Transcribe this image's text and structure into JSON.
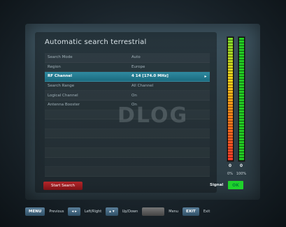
{
  "screen": {
    "title": "Automatic search terrestrial",
    "watermark": "DLOG",
    "menu": [
      {
        "label": "Search Mode",
        "value": "Auto",
        "selected": false
      },
      {
        "label": "Region",
        "value": "Europe",
        "selected": false
      },
      {
        "label": "RF Channel",
        "value": "4 14 [174.0 MHz]",
        "selected": true
      },
      {
        "label": "Search Range",
        "value": "All Channel",
        "selected": false
      },
      {
        "label": "Logical Channel",
        "value": "On",
        "selected": false
      },
      {
        "label": "Antenna Booster",
        "value": "On",
        "selected": false
      }
    ],
    "start_button": "Start Search",
    "signal_label": "Signal",
    "signal_status": "OK",
    "meters": [
      {
        "name": "strength",
        "value_text": "0",
        "percent_text": "0%",
        "level": 1.0,
        "color": "#ff3b2a"
      },
      {
        "name": "quality",
        "value_text": "0",
        "percent_text": "100%",
        "level": 1.0,
        "color": "#22cc22"
      }
    ],
    "selected_arrow": "▸"
  },
  "footer": {
    "keys": [
      {
        "key": "MENU",
        "label": "Previous"
      },
      {
        "key": "◂ ▸",
        "label": "Left/Right"
      },
      {
        "key": "▴ ▾",
        "label": "Up/Down"
      },
      {
        "key": "",
        "label": "Menu"
      },
      {
        "key": "EXIT",
        "label": "Exit"
      }
    ]
  }
}
